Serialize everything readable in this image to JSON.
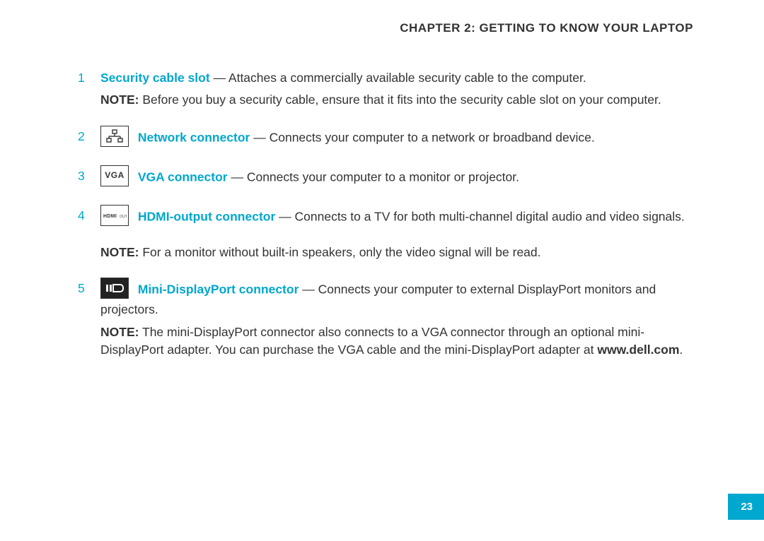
{
  "chapter": "CHAPTER 2: GETTING TO KNOW YOUR LAPTOP",
  "items": [
    {
      "num": "1",
      "term": "Security cable slot",
      "desc": " — Attaches a commercially available security cable to the computer.",
      "note_label": "NOTE:",
      "note": " Before you buy a security cable, ensure that it fits into the security cable slot on your computer."
    },
    {
      "num": "2",
      "icon": "network",
      "term": " Network connector",
      "desc": " — Connects your computer to a network or broadband device."
    },
    {
      "num": "3",
      "icon": "VGA",
      "term": " VGA connector",
      "desc": " — Connects your computer to a monitor or projector."
    },
    {
      "num": "4",
      "icon": "HDMI OUT",
      "term": " HDMI-output connector",
      "desc": " — Connects to a TV for both multi-channel digital audio and video signals.",
      "note_label": "NOTE:",
      "note": " For a monitor without built-in speakers, only the video signal will be read."
    },
    {
      "num": "5",
      "icon": "displayport",
      "term": " Mini-DisplayPort connector",
      "desc": " — Connects your computer to external DisplayPort monitors and projectors.",
      "note_label": "NOTE:",
      "note_pre": " The mini-DisplayPort connector also connects to a VGA connector through an optional mini-DisplayPort adapter. You can purchase the VGA cable and the mini-DisplayPort adapter at ",
      "note_bold": "www.dell.com",
      "note_post": "."
    }
  ],
  "page_number": "23"
}
